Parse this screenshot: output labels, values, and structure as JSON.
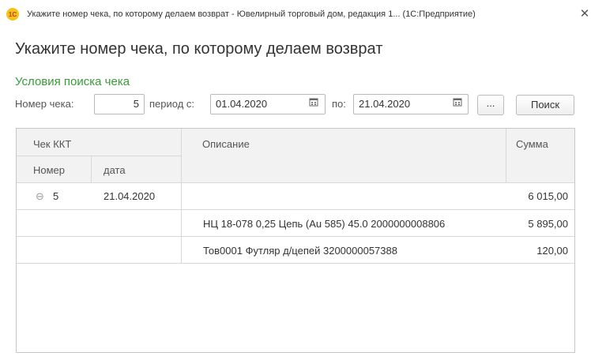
{
  "window": {
    "logo_text": "1С",
    "title": "Укажите номер чека, по которому делаем возврат - Ювелирный торговый дом, редакция 1...  (1С:Предприятие)",
    "close_glyph": "✕"
  },
  "form": {
    "title": "Укажите номер чека, по которому делаем возврат",
    "group_title": "Условия поиска чека"
  },
  "search": {
    "receipt_number_label": "Номер чека:",
    "receipt_number_value": "5",
    "period_from_label": "период с:",
    "period_from_value": "01.04.2020",
    "period_to_label": "по:",
    "period_to_value": "21.04.2020",
    "ellipsis_label": "...",
    "search_button_label": "Поиск"
  },
  "table": {
    "headers": {
      "kkt_receipt": "Чек ККТ",
      "number": "Номер",
      "date": "дата",
      "description": "Описание",
      "amount": "Сумма"
    },
    "rows": [
      {
        "expander": "⊖",
        "number": "5",
        "date": "21.04.2020",
        "description": "",
        "amount": "6 015,00"
      },
      {
        "expander": "",
        "number": "",
        "date": "",
        "description": "НЦ 18-078 0,25 Цепь (Au 585) 45.0 2000000008806",
        "amount": "5 895,00"
      },
      {
        "expander": "",
        "number": "",
        "date": "",
        "description": "Тов0001 Футляр д/цепей  3200000057388",
        "amount": "120,00"
      }
    ]
  },
  "icons": {
    "calendar": "calendar-icon",
    "collapse": "collapse-icon",
    "close": "close-icon"
  },
  "colors": {
    "group_title": "#3a9a3a",
    "header_bg": "#f2f2f2",
    "logo": "#f5c316"
  }
}
